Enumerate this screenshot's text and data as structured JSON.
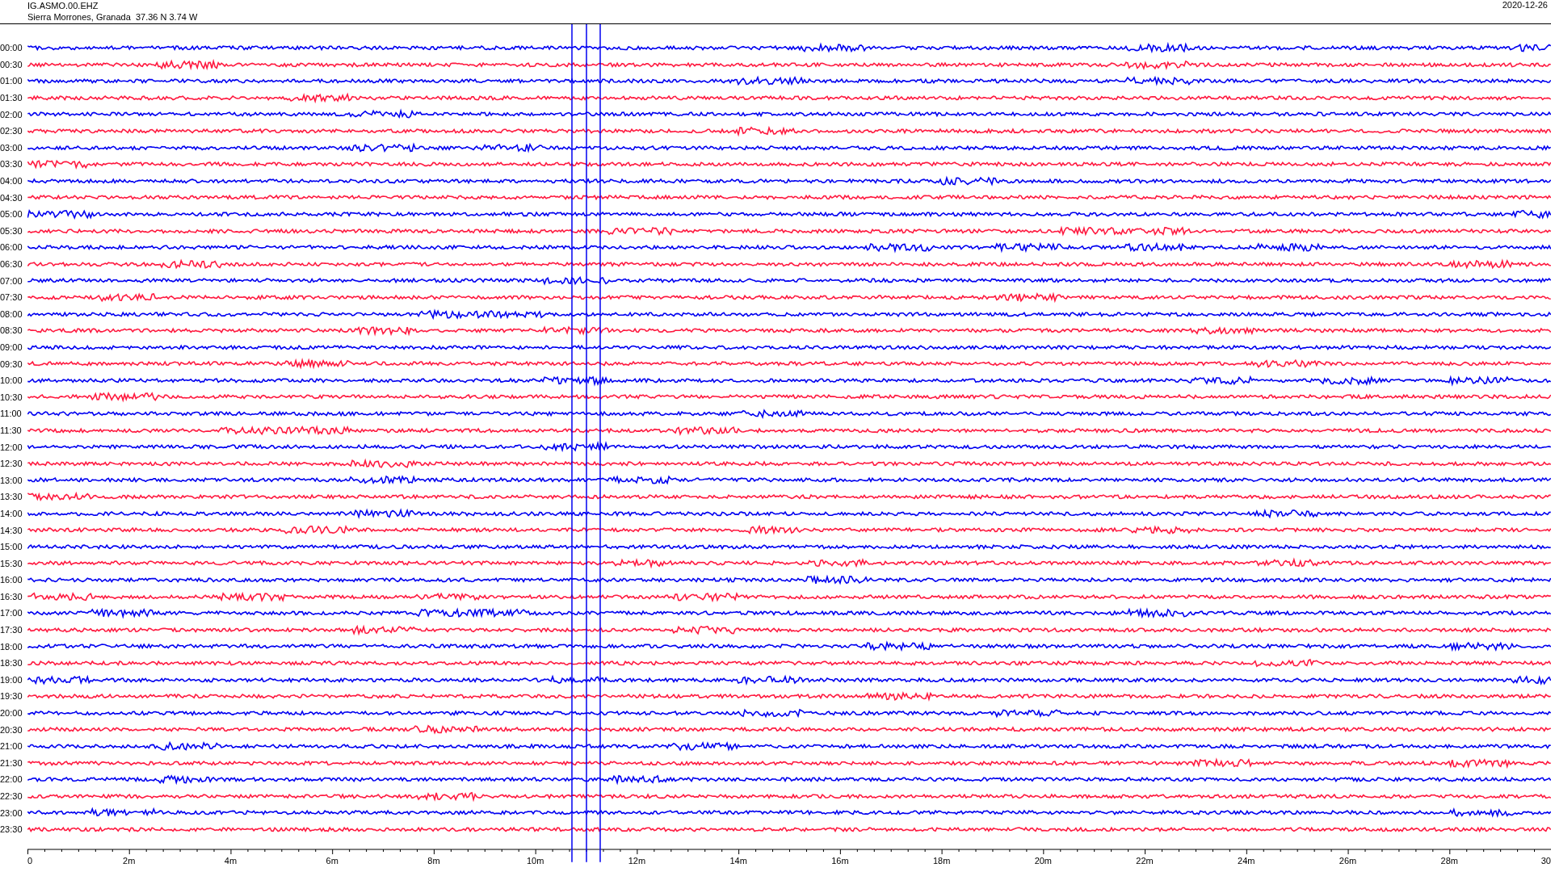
{
  "header": {
    "station": "IG.ASMO.00.EHZ",
    "location": "Sierra Morrones, Granada  37.36 N 3.74 W",
    "date": "2020-12-26"
  },
  "traces": [
    {
      "label": "00:00",
      "color": "#0000f0"
    },
    {
      "label": "00:30",
      "color": "#ff1a40"
    },
    {
      "label": "01:00",
      "color": "#0000f0"
    },
    {
      "label": "01:30",
      "color": "#ff1a40"
    },
    {
      "label": "02:00",
      "color": "#0000f0"
    },
    {
      "label": "02:30",
      "color": "#ff1a40"
    },
    {
      "label": "03:00",
      "color": "#0000f0"
    },
    {
      "label": "03:30",
      "color": "#ff1a40"
    },
    {
      "label": "04:00",
      "color": "#0000f0"
    },
    {
      "label": "04:30",
      "color": "#ff1a40"
    },
    {
      "label": "05:00",
      "color": "#0000f0"
    },
    {
      "label": "05:30",
      "color": "#ff1a40"
    },
    {
      "label": "06:00",
      "color": "#0000f0"
    },
    {
      "label": "06:30",
      "color": "#ff1a40"
    },
    {
      "label": "07:00",
      "color": "#0000f0"
    },
    {
      "label": "07:30",
      "color": "#ff1a40"
    },
    {
      "label": "08:00",
      "color": "#0000f0"
    },
    {
      "label": "08:30",
      "color": "#ff1a40"
    },
    {
      "label": "09:00",
      "color": "#0000f0"
    },
    {
      "label": "09:30",
      "color": "#ff1a40"
    },
    {
      "label": "10:00",
      "color": "#0000f0"
    },
    {
      "label": "10:30",
      "color": "#ff1a40"
    },
    {
      "label": "11:00",
      "color": "#0000f0"
    },
    {
      "label": "11:30",
      "color": "#ff1a40"
    },
    {
      "label": "12:00",
      "color": "#0000f0"
    },
    {
      "label": "12:30",
      "color": "#ff1a40"
    },
    {
      "label": "13:00",
      "color": "#0000f0"
    },
    {
      "label": "13:30",
      "color": "#ff1a40"
    },
    {
      "label": "14:00",
      "color": "#0000f0"
    },
    {
      "label": "14:30",
      "color": "#ff1a40"
    },
    {
      "label": "15:00",
      "color": "#0000f0"
    },
    {
      "label": "15:30",
      "color": "#ff1a40"
    },
    {
      "label": "16:00",
      "color": "#0000f0"
    },
    {
      "label": "16:30",
      "color": "#ff1a40"
    },
    {
      "label": "17:00",
      "color": "#0000f0"
    },
    {
      "label": "17:30",
      "color": "#ff1a40"
    },
    {
      "label": "18:00",
      "color": "#0000f0"
    },
    {
      "label": "18:30",
      "color": "#ff1a40"
    },
    {
      "label": "19:00",
      "color": "#0000f0"
    },
    {
      "label": "19:30",
      "color": "#ff1a40"
    },
    {
      "label": "20:00",
      "color": "#0000f0"
    },
    {
      "label": "20:30",
      "color": "#ff1a40"
    },
    {
      "label": "21:00",
      "color": "#0000f0"
    },
    {
      "label": "21:30",
      "color": "#ff1a40"
    },
    {
      "label": "22:00",
      "color": "#0000f0"
    },
    {
      "label": "22:30",
      "color": "#ff1a40"
    },
    {
      "label": "23:00",
      "color": "#0000f0"
    },
    {
      "label": "23:30",
      "color": "#ff1a40"
    }
  ],
  "x_axis": {
    "ticks": [
      "0",
      "2m",
      "4m",
      "6m",
      "8m",
      "10m",
      "12m",
      "14m",
      "16m",
      "18m",
      "20m",
      "22m",
      "24m",
      "26m",
      "28m",
      "30"
    ]
  }
}
